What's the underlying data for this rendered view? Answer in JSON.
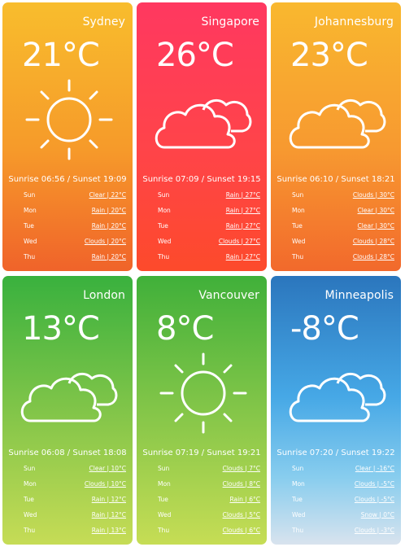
{
  "cards": [
    {
      "city": "Sydney",
      "temp": "21°C",
      "icon": "sun-icon",
      "sun": "Sunrise 06:56 / Sunset 19:09",
      "forecast": [
        {
          "day": "Sun",
          "val": "Clear | 22°C"
        },
        {
          "day": "Mon",
          "val": "Rain | 20°C"
        },
        {
          "day": "Tue",
          "val": "Rain | 20°C"
        },
        {
          "day": "Wed",
          "val": "Clouds | 20°C"
        },
        {
          "day": "Thu",
          "val": "Rain | 20°C"
        }
      ]
    },
    {
      "city": "Singapore",
      "temp": "26°C",
      "icon": "cloud-icon",
      "sun": "Sunrise 07:09 / Sunset 19:15",
      "forecast": [
        {
          "day": "Sun",
          "val": "Rain | 27°C"
        },
        {
          "day": "Mon",
          "val": "Rain | 27°C"
        },
        {
          "day": "Tue",
          "val": "Rain | 27°C"
        },
        {
          "day": "Wed",
          "val": "Clouds | 27°C"
        },
        {
          "day": "Thu",
          "val": "Rain | 27°C"
        }
      ]
    },
    {
      "city": "Johannesburg",
      "temp": "23°C",
      "icon": "cloud-icon",
      "sun": "Sunrise 06:10 / Sunset 18:21",
      "forecast": [
        {
          "day": "Sun",
          "val": "Clouds | 30°C"
        },
        {
          "day": "Mon",
          "val": "Clear | 30°C"
        },
        {
          "day": "Tue",
          "val": "Clear | 30°C"
        },
        {
          "day": "Wed",
          "val": "Clouds | 28°C"
        },
        {
          "day": "Thu",
          "val": "Clouds | 28°C"
        }
      ]
    },
    {
      "city": "London",
      "temp": "13°C",
      "icon": "cloud-icon",
      "sun": "Sunrise 06:08 / Sunset 18:08",
      "forecast": [
        {
          "day": "Sun",
          "val": "Clear | 10°C"
        },
        {
          "day": "Mon",
          "val": "Clouds | 10°C"
        },
        {
          "day": "Tue",
          "val": "Rain | 12°C"
        },
        {
          "day": "Wed",
          "val": "Rain | 12°C"
        },
        {
          "day": "Thu",
          "val": "Rain | 13°C"
        }
      ]
    },
    {
      "city": "Vancouver",
      "temp": "8°C",
      "icon": "sun-icon",
      "sun": "Sunrise 07:19 / Sunset 19:21",
      "forecast": [
        {
          "day": "Sun",
          "val": "Clouds | 7°C"
        },
        {
          "day": "Mon",
          "val": "Clouds | 8°C"
        },
        {
          "day": "Tue",
          "val": "Rain | 6°C"
        },
        {
          "day": "Wed",
          "val": "Clouds | 5°C"
        },
        {
          "day": "Thu",
          "val": "Clouds | 6°C"
        }
      ]
    },
    {
      "city": "Minneapolis",
      "temp": "-8°C",
      "icon": "cloud-icon",
      "sun": "Sunrise 07:20 / Sunset 19:22",
      "forecast": [
        {
          "day": "Sun",
          "val": "Clear | -16°C"
        },
        {
          "day": "Mon",
          "val": "Clouds | -5°C"
        },
        {
          "day": "Tue",
          "val": "Clouds | -5°C"
        },
        {
          "day": "Wed",
          "val": "Snow | 0°C"
        },
        {
          "day": "Thu",
          "val": "Clouds | -3°C"
        }
      ]
    }
  ]
}
